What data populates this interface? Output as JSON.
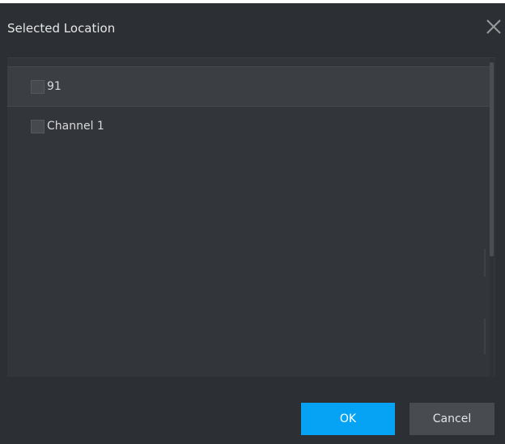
{
  "dialog": {
    "title": "Selected Location",
    "close_icon": "close-icon"
  },
  "tree": {
    "items": [
      {
        "label": "91",
        "checked": false,
        "highlighted": true
      },
      {
        "label": "Channel 1",
        "checked": false,
        "highlighted": false
      }
    ]
  },
  "buttons": {
    "ok_label": "OK",
    "cancel_label": "Cancel"
  },
  "colors": {
    "background": "#2c2f33",
    "panel": "#323539",
    "accent": "#06a3f5",
    "secondary_button": "#484b50"
  }
}
